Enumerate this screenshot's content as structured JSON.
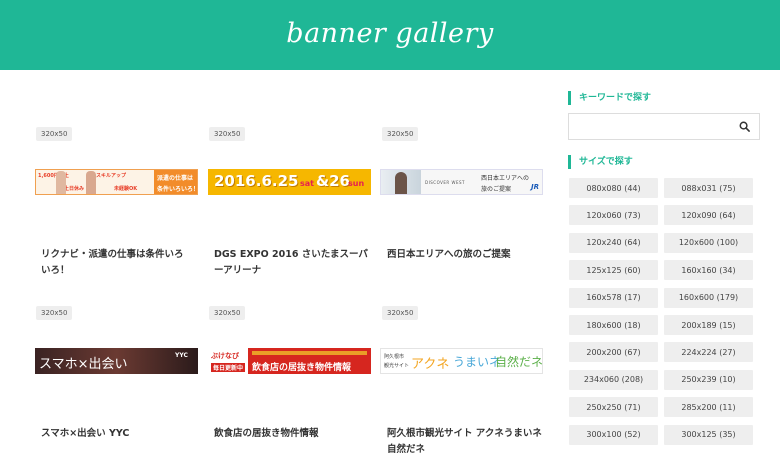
{
  "header": {
    "logo": "banner gallery"
  },
  "cards": [
    {
      "size": "320x50",
      "title": "リクナビ・派遣の仕事は条件いろいろ！",
      "banner_text": [
        "1,600円以上",
        "スキルアップ",
        "土日休み",
        "未経験OK",
        "派遣の仕事は",
        "条件いろいろ！"
      ]
    },
    {
      "size": "320x50",
      "title": "DGS EXPO 2016 さいたまスーパーアリーナ",
      "banner_text": [
        "2016.6.25",
        "sat",
        "&26",
        "sun"
      ]
    },
    {
      "size": "320x50",
      "title": "西日本エリアへの旅のご提案",
      "banner_text": [
        "DISCOVER WEST",
        "西日本エリアへの",
        "旅のご提案",
        "JR"
      ]
    },
    {
      "size": "320x50",
      "title": "スマホ×出会い YYC",
      "banner_text": [
        "スマホ×出会い",
        "YYC"
      ]
    },
    {
      "size": "320x50",
      "title": "飲食店の居抜き物件情報",
      "banner_text": [
        "ぶけなび",
        "毎日更新中",
        "飲食店の居抜き物件情報"
      ]
    },
    {
      "size": "320x50",
      "title": "阿久根市観光サイト アクネうまいネ自然だネ",
      "banner_text": [
        "阿久根市",
        "観光サイト",
        "アクネ",
        "うまいネ",
        "自然だネ"
      ]
    }
  ],
  "sidebar": {
    "keyword_title": "キーワードで探す",
    "size_title": "サイズで探す",
    "sizes": [
      "080x080 (44)",
      "088x031 (75)",
      "120x060 (73)",
      "120x090 (64)",
      "120x240 (64)",
      "120x600 (100)",
      "125x125 (60)",
      "160x160 (34)",
      "160x578 (17)",
      "160x600 (179)",
      "180x600 (18)",
      "200x189 (15)",
      "200x200 (67)",
      "224x224 (27)",
      "234x060 (208)",
      "250x239 (10)",
      "250x250 (71)",
      "285x200 (11)",
      "300x100 (52)",
      "300x125 (35)"
    ]
  },
  "colors": {
    "accent": "#1fb796"
  }
}
